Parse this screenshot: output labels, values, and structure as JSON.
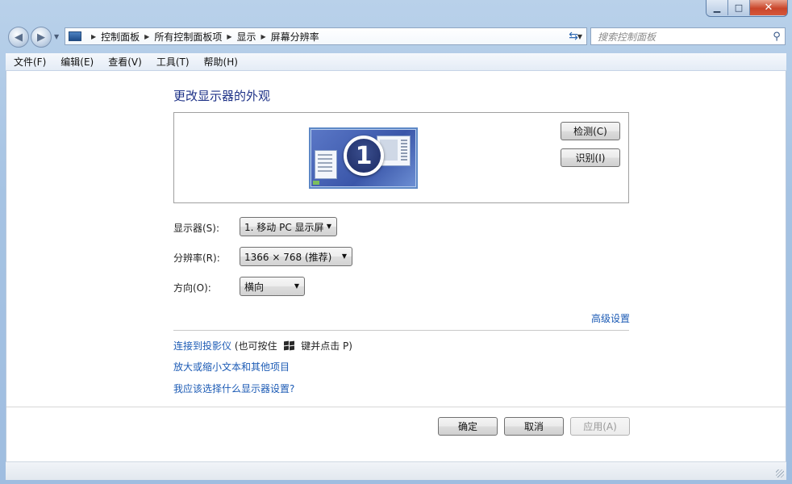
{
  "window": {
    "caption_buttons": {
      "minimize": "▁",
      "maximize": "□",
      "close": "✕"
    }
  },
  "nav": {
    "breadcrumbs": [
      "控制面板",
      "所有控制面板项",
      "显示",
      "屏幕分辨率"
    ],
    "search_placeholder": "搜索控制面板",
    "icons": {
      "back": "◀",
      "forward": "▶",
      "dropdown": "▼",
      "refresh": "⇆",
      "search": "⚲",
      "separator": "▶"
    }
  },
  "menubar": {
    "items": [
      "文件(F)",
      "编辑(E)",
      "查看(V)",
      "工具(T)",
      "帮助(H)"
    ]
  },
  "main": {
    "heading": "更改显示器的外观",
    "monitor_number": "1",
    "detect_button": "检测(C)",
    "identify_button": "识别(I)",
    "display_label": "显示器(S):",
    "display_value": "1. 移动 PC 显示屏",
    "resolution_label": "分辨率(R):",
    "resolution_value": "1366 × 768 (推荐)",
    "orientation_label": "方向(O):",
    "orientation_value": "横向",
    "advanced_link": "高级设置",
    "projector_link": "连接到投影仪",
    "projector_hint_before": "(也可按住",
    "projector_hint_after": "键并点击 P)",
    "text_size_link": "放大或缩小文本和其他项目",
    "help_link": "我应该选择什么显示器设置?"
  },
  "footer": {
    "ok_button": "确定",
    "cancel_button": "取消",
    "apply_button": "应用(A)"
  },
  "colors": {
    "heading": "#1e3287",
    "link": "#1c5bb5",
    "frame": "#a6c3e3"
  }
}
